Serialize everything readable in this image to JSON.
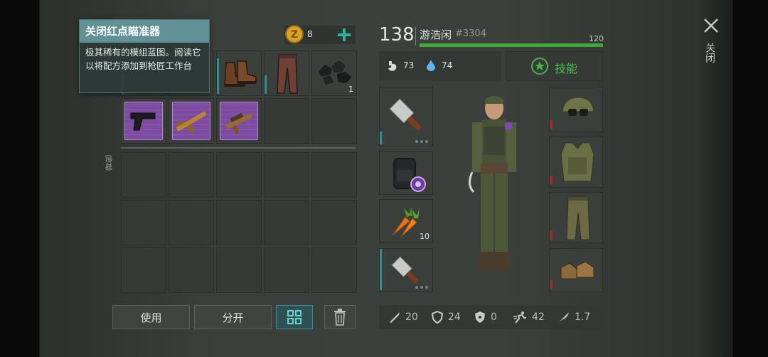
{
  "tooltip": {
    "title": "关闭红点瞄准器",
    "description": "极其稀有的模组蓝图。阅读它以将配方添加到枪匠工作台"
  },
  "currency": {
    "amount": "8"
  },
  "inventory": {
    "backpack_label": "背包",
    "items": [
      {
        "name": "boots-item",
        "count": ""
      },
      {
        "name": "pants-item",
        "count": ""
      },
      {
        "name": "coal-item",
        "count": "1"
      },
      {
        "name": "pistol-blueprint",
        "count": ""
      },
      {
        "name": "rifle-blueprint",
        "count": ""
      },
      {
        "name": "scope-blueprint",
        "count": ""
      }
    ]
  },
  "buttons": {
    "use": "使用",
    "split": "分开"
  },
  "player": {
    "level": "138",
    "name": "游浩闲",
    "id": "#3304",
    "hp_max": "120",
    "hp_fraction": 1.0,
    "food": "73",
    "water": "74",
    "skills_label": "技能"
  },
  "equipment": {
    "carrot_count": "10"
  },
  "stats": {
    "attack": "20",
    "defense": "24",
    "radiation": "0",
    "speed": "42",
    "weight": "1.7"
  },
  "close": {
    "label": "关闭"
  },
  "colors": {
    "hp_bar": "#3fa83a",
    "accent_teal": "#2f8f93",
    "skills_green": "#4cb04a",
    "blueprint_purple": "#7d4ca0"
  }
}
